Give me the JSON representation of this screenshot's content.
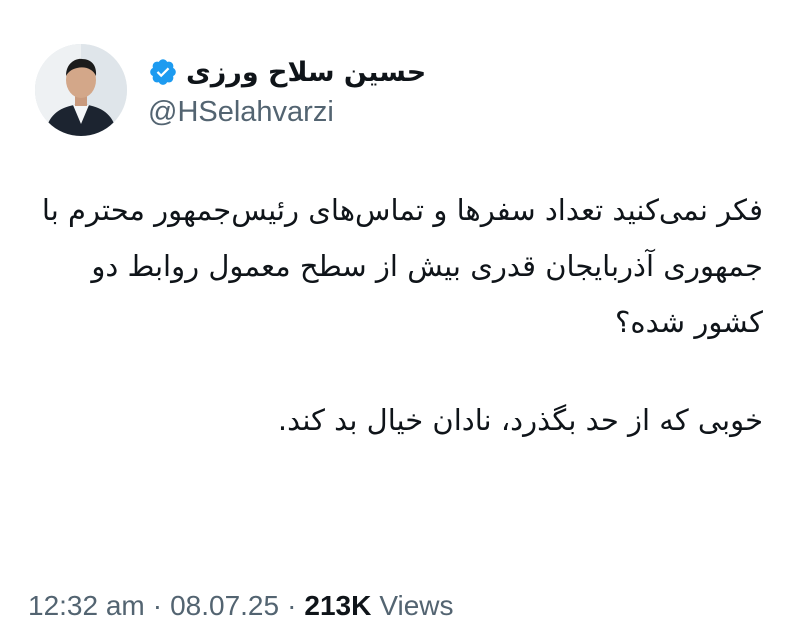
{
  "author": {
    "display_name": "حسین سلاح ورزی",
    "handle": "@HSelahvarzi",
    "verified": true,
    "verified_color": "#1d9bf0"
  },
  "tweet": {
    "paragraph_1": "فکر نمی‌کنید تعداد سفرها و تماس‌های رئیس‌جمهور محترم با جمهوری آذربایجان قدری بیش از سطح معمول روابط دو کشور شده؟",
    "paragraph_2": "خوبی که از حد بگذرد، نادان خیال بد کند."
  },
  "meta": {
    "time": "12:32 am",
    "separator": "·",
    "date": "08.07.25",
    "views_count": "213K",
    "views_label": "Views"
  },
  "colors": {
    "text_primary": "#0f1419",
    "text_secondary": "#536471",
    "background": "#ffffff"
  },
  "icons": {
    "verified": "verified-badge-icon",
    "avatar": "profile-photo"
  }
}
